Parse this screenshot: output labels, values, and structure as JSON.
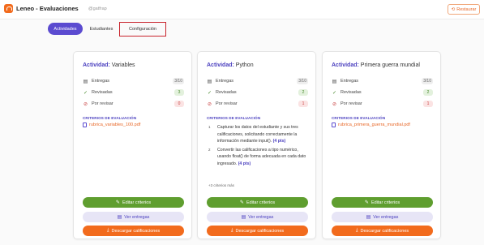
{
  "app": {
    "title": "Leneo - Evaluaciones",
    "user": "@gatfrap",
    "restore_label": "Restaurar",
    "brand_color": "#f26b1d"
  },
  "tabs": [
    {
      "label": "Actividades",
      "active": true
    },
    {
      "label": "Estudiantes",
      "active": false
    },
    {
      "label": "Configuración",
      "active": false
    }
  ],
  "cards": [
    {
      "keyword": "Actividad:",
      "name": "Variables",
      "stats": [
        {
          "label": "Entregas",
          "value": "3/10"
        },
        {
          "label": "Revisadas",
          "value": "3"
        },
        {
          "label": "Por revisar",
          "value": "0"
        }
      ],
      "criteria_title": "CRITERIOS DE EVALUACIÓN",
      "criteria_file": "rubrica_variables_100.pdf",
      "edit_label": "Editar criterios",
      "view_label": "Ver entregas",
      "download_label": "Descargar calificaciones"
    },
    {
      "keyword": "Actividad:",
      "name": "Python",
      "stats": [
        {
          "label": "Entregas",
          "value": "3/10"
        },
        {
          "label": "Revisadas",
          "value": "2"
        },
        {
          "label": "Por revisar",
          "value": "1"
        }
      ],
      "criteria_title": "CRITERIOS DE EVALUACIÓN",
      "criteria_items": [
        {
          "num": "1",
          "text": "Capturar los datos del estudiante y sus tres calificaciones, solicitando correctamente la información mediante input().",
          "points": "(4 pts)"
        },
        {
          "num": "2",
          "text": "Convertir las calificaciones a tipo numérico, usando float() de forma adecuada en cada dato ingresado.",
          "points": "(4 pts)"
        }
      ],
      "more_label": "+3 criterios más",
      "edit_label": "Editar criterios",
      "view_label": "Ver entregas",
      "download_label": "Descargar calificaciones"
    },
    {
      "keyword": "Actividad:",
      "name": "Primera guerra mundial",
      "stats": [
        {
          "label": "Entregas",
          "value": "3/10"
        },
        {
          "label": "Revisadas",
          "value": "2"
        },
        {
          "label": "Por revisar",
          "value": "1"
        }
      ],
      "criteria_title": "CRITERIOS DE EVALUACIÓN",
      "criteria_file": "rubrica_primera_guerra_mundial.pdf",
      "edit_label": "Editar criterios",
      "view_label": "Ver entregas",
      "download_label": "Descargar calificaciones"
    }
  ]
}
